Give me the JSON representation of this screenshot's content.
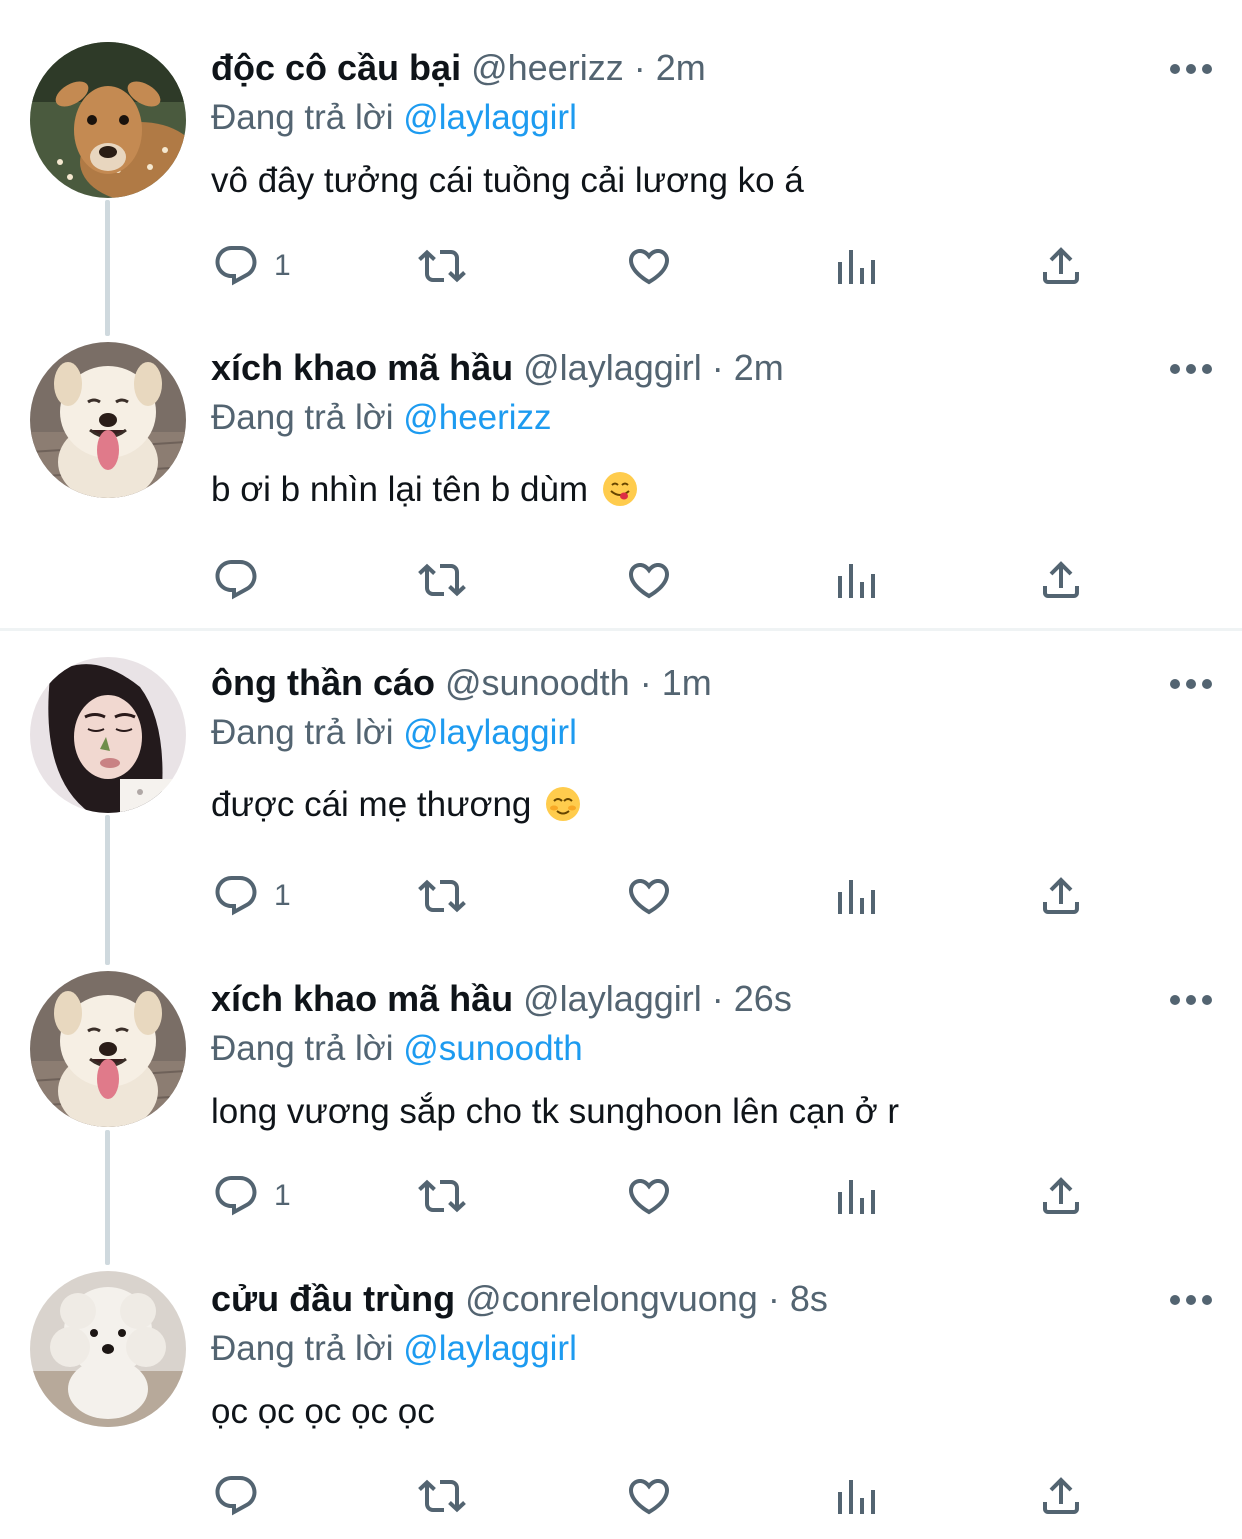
{
  "tweets": [
    {
      "name": "độc cô cầu bại",
      "handle": "@heerizz",
      "dot": "·",
      "time": "2m",
      "replying_prefix": "Đang trả lời",
      "replying_to": "@laylaggirl",
      "text": "vô đây tưởng cái tuồng cải lương ko á",
      "reply_count": "1",
      "avatar": "deer-avatar"
    },
    {
      "name": "xích khao mã hầu",
      "handle": "@laylaggirl",
      "dot": "·",
      "time": "2m",
      "replying_prefix": "Đang trả lời",
      "replying_to": "@heerizz",
      "text": "b ơi b nhìn lại tên b dùm",
      "emoji": "yum-face-emoji",
      "reply_count": "",
      "avatar": "dog-avatar"
    },
    {
      "name": "ông thần cáo",
      "handle": "@sunoodth",
      "dot": "·",
      "time": "1m",
      "replying_prefix": "Đang trả lời",
      "replying_to": "@laylaggirl",
      "text": "được cái mẹ thương",
      "emoji": "smiling-blush-emoji",
      "reply_count": "1",
      "avatar": "girl-avatar"
    },
    {
      "name": "xích khao mã hầu",
      "handle": "@laylaggirl",
      "dot": "·",
      "time": "26s",
      "replying_prefix": "Đang trả lời",
      "replying_to": "@sunoodth",
      "text": "long vương sắp cho tk sunghoon lên cạn ở r",
      "reply_count": "1",
      "avatar": "dog-avatar"
    },
    {
      "name": "cửu đầu trùng",
      "handle": "@conrelongvuong",
      "dot": "·",
      "time": "8s",
      "replying_prefix": "Đang trả lời",
      "replying_to": "@laylaggirl",
      "text": "ọc ọc ọc ọc ọc",
      "reply_count": "",
      "avatar": "poodle-avatar"
    }
  ],
  "icons": {
    "reply": "reply-icon",
    "retweet": "retweet-icon",
    "like": "heart-icon",
    "views": "views-icon",
    "share": "share-icon",
    "more": "more-icon"
  },
  "colors": {
    "link": "#1d9bf0",
    "secondary": "#536471",
    "thread_line": "#cfd9de"
  }
}
